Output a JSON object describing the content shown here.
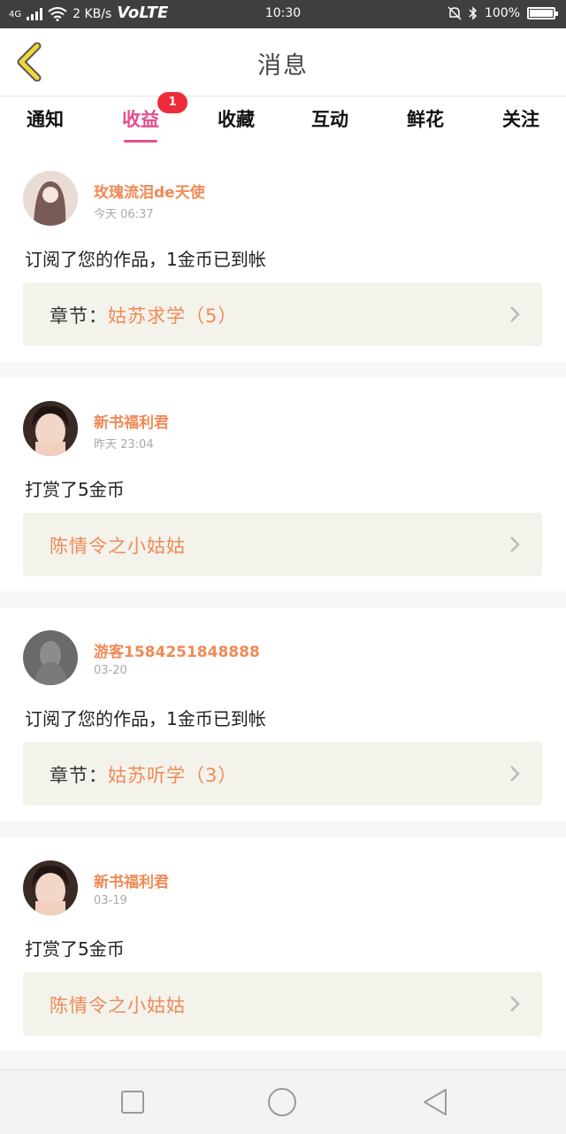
{
  "status_bar": {
    "network": "4G",
    "speed": "2 KB/s",
    "volte": "VoLTE",
    "time": "10:30",
    "battery_text": "100%",
    "battery_level": 1.0
  },
  "header": {
    "title": "消息"
  },
  "tabs": [
    {
      "label": "通知",
      "active": false
    },
    {
      "label": "收益",
      "active": true,
      "badge": "1"
    },
    {
      "label": "收藏",
      "active": false
    },
    {
      "label": "互动",
      "active": false
    },
    {
      "label": "鲜花",
      "active": false
    },
    {
      "label": "关注",
      "active": false
    }
  ],
  "messages": [
    {
      "user": "玫瑰流泪de天使",
      "time": "今天 06:37",
      "text": "订阅了您的作品，1金币已到帐",
      "link_prefix": "章节：",
      "link_title": "姑苏求学（5）"
    },
    {
      "user": "新书福利君",
      "time": "昨天 23:04",
      "text": "打赏了5金币",
      "link_prefix": "",
      "link_title": "陈情令之小姑姑"
    },
    {
      "user": "游客1584251848888",
      "time": "03-20",
      "text": "订阅了您的作品，1金币已到帐",
      "link_prefix": "章节：",
      "link_title": "姑苏听学（3）"
    },
    {
      "user": "新书福利君",
      "time": "03-19",
      "text": "打赏了5金币",
      "link_prefix": "",
      "link_title": "陈情令之小姑姑"
    }
  ],
  "colors": {
    "accent": "#e34f8c",
    "username": "#f08a56",
    "badge": "#ee2b3b",
    "back_arrow": "#f1d63a"
  }
}
